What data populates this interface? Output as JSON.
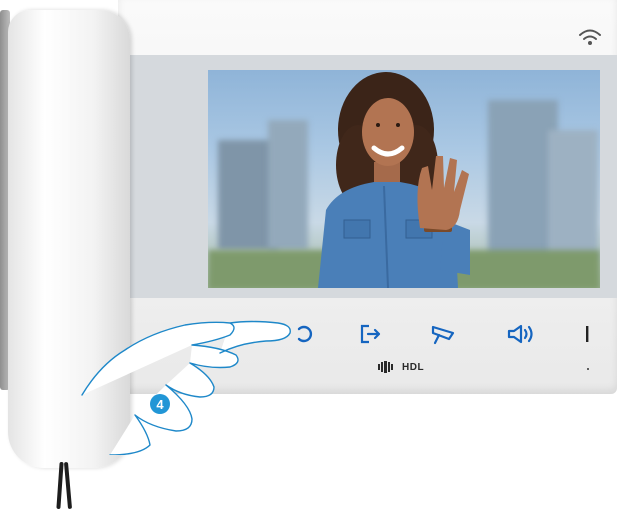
{
  "device": {
    "brand": "HDL",
    "accent_color": "#1565c0",
    "status_icon": "wifi-icon"
  },
  "controls": [
    {
      "name": "unlock-button",
      "icon": "key-icon"
    },
    {
      "name": "door-release-button",
      "icon": "door-exit-icon"
    },
    {
      "name": "camera-button",
      "icon": "camera-icon"
    },
    {
      "name": "volume-button",
      "icon": "speaker-icon"
    },
    {
      "name": "power-button",
      "icon": "power-icon"
    }
  ],
  "callout": {
    "step_number": "4",
    "color": "#2196d6"
  }
}
